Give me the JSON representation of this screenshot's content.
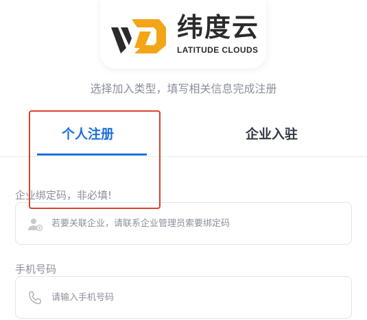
{
  "brand": {
    "name_cn": "纬度云",
    "name_en": "LATITUDE CLOUDS",
    "colors": {
      "orange": "#f2a516",
      "dark": "#2b2b2b"
    }
  },
  "subtitle": "选择加入类型，填写相关信息完成注册",
  "tabs": [
    {
      "label": "个人注册",
      "active": true
    },
    {
      "label": "企业入驻",
      "active": false
    }
  ],
  "form": {
    "enterprise_code": {
      "label": "企业绑定码，非必填!",
      "placeholder": "若要关联企业，请联系企业管理员索要绑定码",
      "icon": "add-user-icon"
    },
    "phone": {
      "label": "手机号码",
      "placeholder": "请输入手机号码",
      "icon": "phone-icon"
    }
  },
  "colors": {
    "accent": "#1a6fe0",
    "highlight": "#d9402e"
  }
}
